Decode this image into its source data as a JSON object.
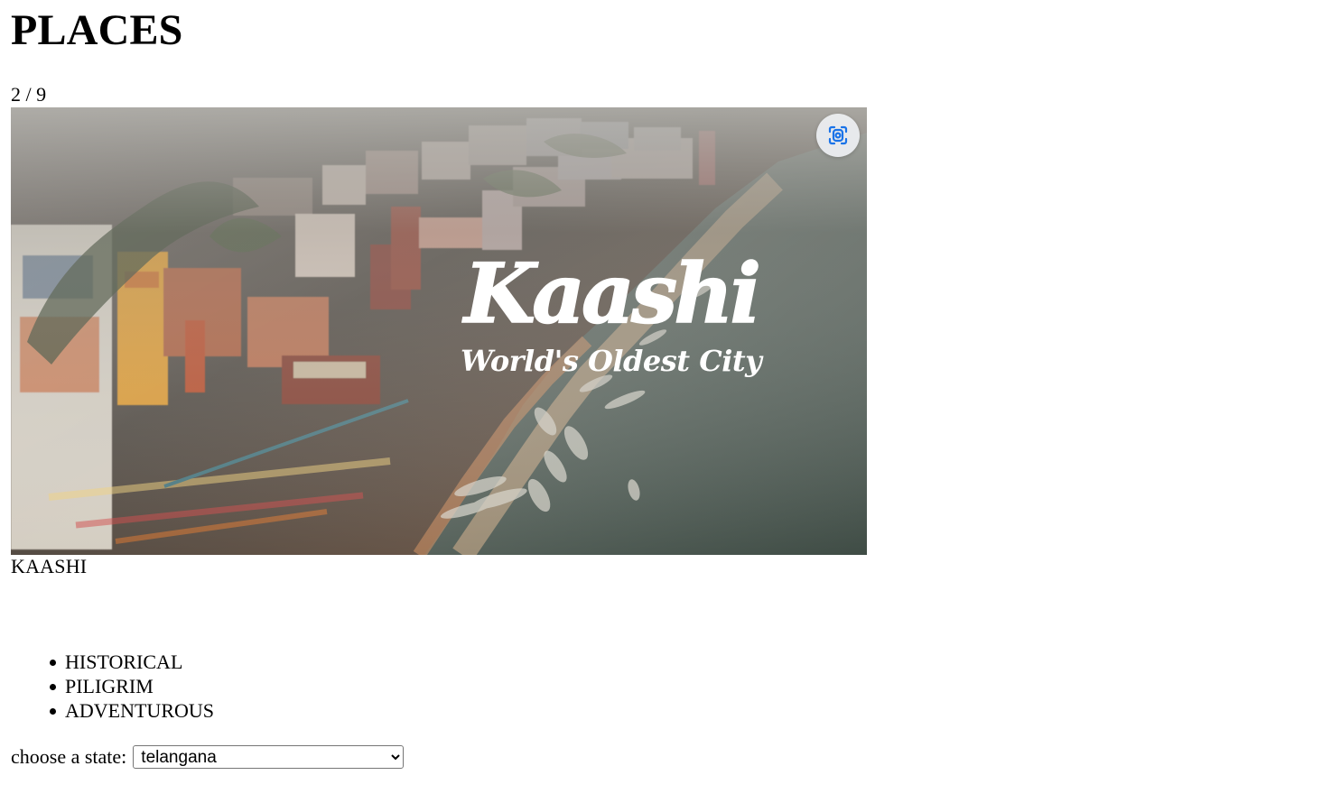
{
  "page": {
    "title": "PLACES",
    "slide_counter": "2 / 9"
  },
  "hero": {
    "image_subject": "aerial view of Kaashi ghats beside the river",
    "logo_title": "Kaashi",
    "logo_subtitle": "World's Oldest City",
    "lens_icon": "lens-search-icon"
  },
  "place": {
    "name": "KAASHI"
  },
  "categories": [
    "HISTORICAL",
    "PILIGRIM",
    "ADVENTUROUS"
  ],
  "state": {
    "label": "choose a state:",
    "selected": "telangana"
  },
  "colors": {
    "page_background": "#ffffff",
    "text": "#000000",
    "lens_button": "#eceef1",
    "lens_icon": "#1a73e8"
  }
}
